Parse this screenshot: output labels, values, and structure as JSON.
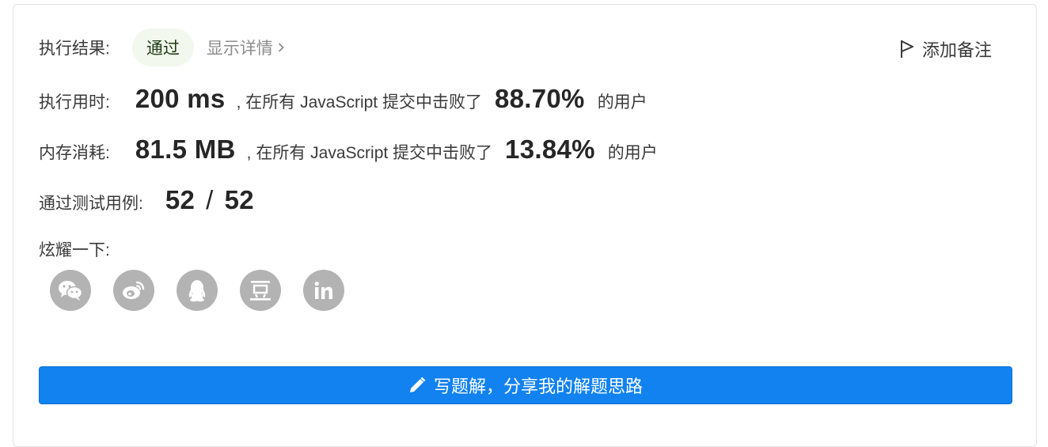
{
  "result": {
    "label": "执行结果:",
    "status": "通过",
    "details_link": "显示详情"
  },
  "add_note": "添加备注",
  "runtime": {
    "label": "执行用时:",
    "value": "200 ms",
    "mid_text": ", 在所有 JavaScript 提交中击败了",
    "percent": "88.70%",
    "suffix": "的用户"
  },
  "memory": {
    "label": "内存消耗:",
    "value": "81.5 MB",
    "mid_text": ", 在所有 JavaScript 提交中击败了",
    "percent": "13.84%",
    "suffix": "的用户"
  },
  "testcases": {
    "label": "通过测试用例:",
    "passed": "52",
    "separator": "/",
    "total": "52"
  },
  "share": {
    "label": "炫耀一下:",
    "icons": [
      "wechat-icon",
      "weibo-icon",
      "qq-icon",
      "douban-icon",
      "linkedin-icon"
    ]
  },
  "solution_button": "写题解，分享我的解题思路",
  "colors": {
    "primary_button": "#1182f0",
    "success_badge_bg": "#f3f8ef",
    "share_icon_bg": "#b3b3b3"
  }
}
